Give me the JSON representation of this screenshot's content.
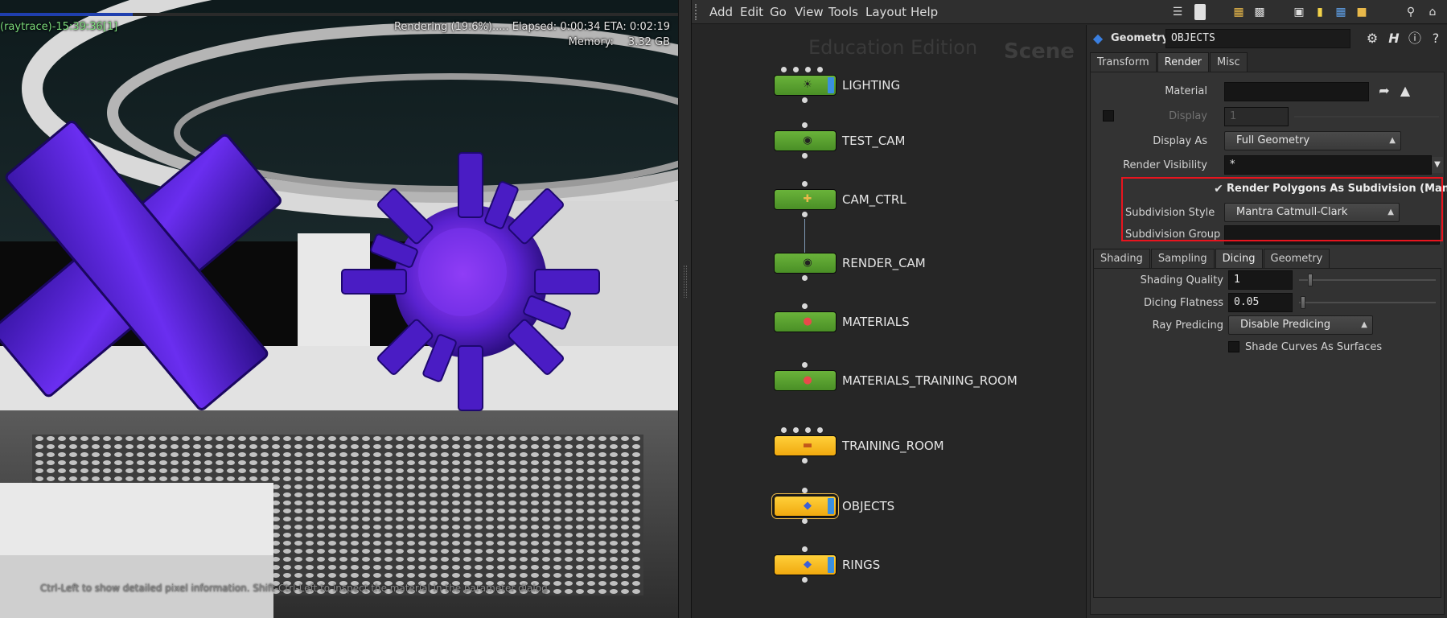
{
  "render_view": {
    "renderer_label": "(raytrace)-15:39:36[1]",
    "status": "Rendering (19.6%).....   Elapsed: 0:00:34   ETA: 0:02:19",
    "memory_label": "Memory:",
    "memory_value": "3.32 GB",
    "progress_fraction": 0.196,
    "hint": "Ctrl-Left to show detailed pixel information. Shift-Ctrl-Left to inspect the material in the parameter dialog",
    "colors": {
      "progress": "#1f3fae",
      "renderer_label": "#7cdc7c",
      "objects": "#5b26d6"
    }
  },
  "menubar": {
    "items": [
      "Add",
      "Edit",
      "Go",
      "View",
      "Tools",
      "Layout",
      "Help"
    ]
  },
  "network": {
    "edition_watermark": "Education Edition",
    "context_watermark": "Scene",
    "nodes": [
      {
        "label": "LIGHTING",
        "color": "green",
        "icon": "light-icon"
      },
      {
        "label": "TEST_CAM",
        "color": "green",
        "icon": "camera-icon"
      },
      {
        "label": "CAM_CTRL",
        "color": "green",
        "icon": "null-icon"
      },
      {
        "label": "RENDER_CAM",
        "color": "green",
        "icon": "camera-icon"
      },
      {
        "label": "MATERIALS",
        "color": "green",
        "icon": "material-icon"
      },
      {
        "label": "MATERIALS_TRAINING_ROOM",
        "color": "green",
        "icon": "material-icon"
      },
      {
        "label": "TRAINING_ROOM",
        "color": "yellow",
        "icon": "subnet-icon"
      },
      {
        "label": "OBJECTS",
        "color": "yellow",
        "icon": "geometry-icon"
      },
      {
        "label": "RINGS",
        "color": "yellow",
        "icon": "geometry-icon"
      }
    ]
  },
  "params": {
    "node_type": "Geometry",
    "node_name": "OBJECTS",
    "top_tabs": [
      "Transform",
      "Render",
      "Misc"
    ],
    "material_label": "Material",
    "material_value": "",
    "display_label": "Display",
    "display_value": "1",
    "display_as_label": "Display As",
    "display_as_value": "Full Geometry",
    "render_visibility_label": "Render Visibility",
    "render_visibility_value": "*",
    "render_subdiv_label": "Render Polygons As Subdivision (Mantra)",
    "render_subdiv_checked": true,
    "subdivision_style_label": "Subdivision Style",
    "subdivision_style_value": "Mantra Catmull-Clark",
    "subdivision_group_label": "Subdivision Group",
    "subdivision_group_value": "",
    "sub_tabs": [
      "Shading",
      "Sampling",
      "Dicing",
      "Geometry"
    ],
    "shading_quality_label": "Shading Quality",
    "shading_quality_value": "1",
    "dicing_flatness_label": "Dicing Flatness",
    "dicing_flatness_value": "0.05",
    "ray_predicing_label": "Ray Predicing",
    "ray_predicing_value": "Disable Predicing",
    "shade_curves_label": "Shade Curves As Surfaces",
    "shade_curves_checked": false
  }
}
